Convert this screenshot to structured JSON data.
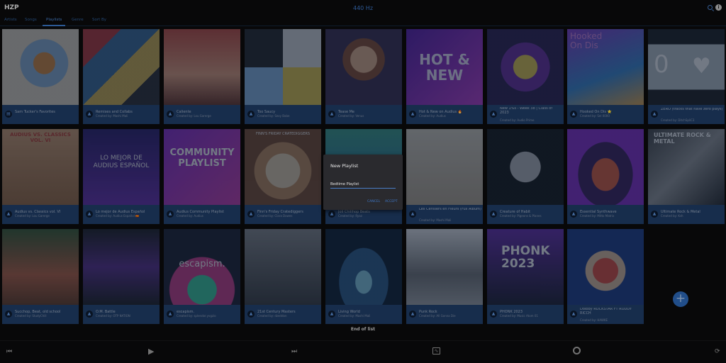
{
  "app": {
    "name": "HZP",
    "subtitle": "440 Hz"
  },
  "tabs": [
    {
      "label": "Artists"
    },
    {
      "label": "Songs"
    },
    {
      "label": "Playlists"
    },
    {
      "label": "Genre"
    },
    {
      "label": "Sort By"
    }
  ],
  "playlists": [
    {
      "title": "Sam Tucker's Favorites",
      "by": ""
    },
    {
      "title": "Remixes and Collabs",
      "by": "Created by: Mashi Mali"
    },
    {
      "title": "Caliente",
      "by": "Created by: Lou Garerge"
    },
    {
      "title": "Too Saucy",
      "by": "Created by: Sexy Babe"
    },
    {
      "title": "Tease Me",
      "by": "Created by: Venus"
    },
    {
      "title": "Hot & New on Audius 🔥",
      "by": "Created by: Audius"
    },
    {
      "title": "New 1%s - Week 38 | Class of 2023",
      "by": "Created by: Audio Prime"
    },
    {
      "title": "Hooked On Dis ⭐",
      "by": "Created by: Sel 0000"
    },
    {
      "title": "ZERO (tracks that have zero plays)",
      "by": "Created by: DitchSpliC3"
    },
    {
      "title": "Audius vs. Classics vol. VI",
      "by": "Created by: Lou Garerge"
    },
    {
      "title": "Lo mejor de Audius Español",
      "by": "Created by: Audius Español 🇪🇸"
    },
    {
      "title": "Audius Community Playlist",
      "by": "Created by: Audius"
    },
    {
      "title": "Finn's Friday Cratediggers",
      "by": "Created by: Clara Dawes"
    },
    {
      "title": "Joli Chillhop Beats",
      "by": "Created by: Ryaz"
    },
    {
      "title": "Les Cerisiers en Fleurs (Full Album)",
      "by": "Created by: Mashi Mali"
    },
    {
      "title": "Creature of Habit",
      "by": "Created by: Pigeons & Planes"
    },
    {
      "title": "Essential Synthwave",
      "by": "Created by: Mitto Matrix"
    },
    {
      "title": "Ultimate Rock & Metal",
      "by": "Created by: Ksh"
    },
    {
      "title": "Succhop, Beat, old school",
      "by": "Created by: StudyChill"
    },
    {
      "title": "O.M. Battle",
      "by": "Created by: OTP NATION"
    },
    {
      "title": "escapism.",
      "by": "Created by: splendor.yvgzio"
    },
    {
      "title": "21st Century Masters",
      "by": "Created by: dzeddon"
    },
    {
      "title": "Living World",
      "by": "Created by: Mashi Mali"
    },
    {
      "title": "Punk Rock",
      "by": "Created by: All Gonna Die"
    },
    {
      "title": "PHONK 2023",
      "by": "Created by: Music Atom 01"
    },
    {
      "title": "Dolbby ROCKSTAR FT RODDY RICCH",
      "by": "Created by: HAWKE"
    }
  ],
  "art_text": {
    "hot_new": "HOT & NEW",
    "hooked": "Hooked On Dis",
    "zero": "0",
    "classics": "AUDIUS VS. CLASSICS VOL. VI",
    "lo_mejor": "LO MEJOR DE AUDIUS ESPAÑOL",
    "community": "COMMUNITY PLAYLIST",
    "finn": "FINN'S FRIDAY CRATEDIGGERS",
    "ultimate": "ULTIMATE ROCK & METAL",
    "escapism": "escapism.",
    "phonk": "PHONK 2023"
  },
  "footer": {
    "end_label": "End of list"
  },
  "dialog": {
    "title": "New Playlist",
    "value": "Bedtime Playlist",
    "cancel": "CANCEL",
    "accept": "ACCEPT"
  },
  "colors": {
    "accent": "#3e78c8",
    "card_meta": "#1f3c66",
    "background": "#0b0b0d"
  }
}
